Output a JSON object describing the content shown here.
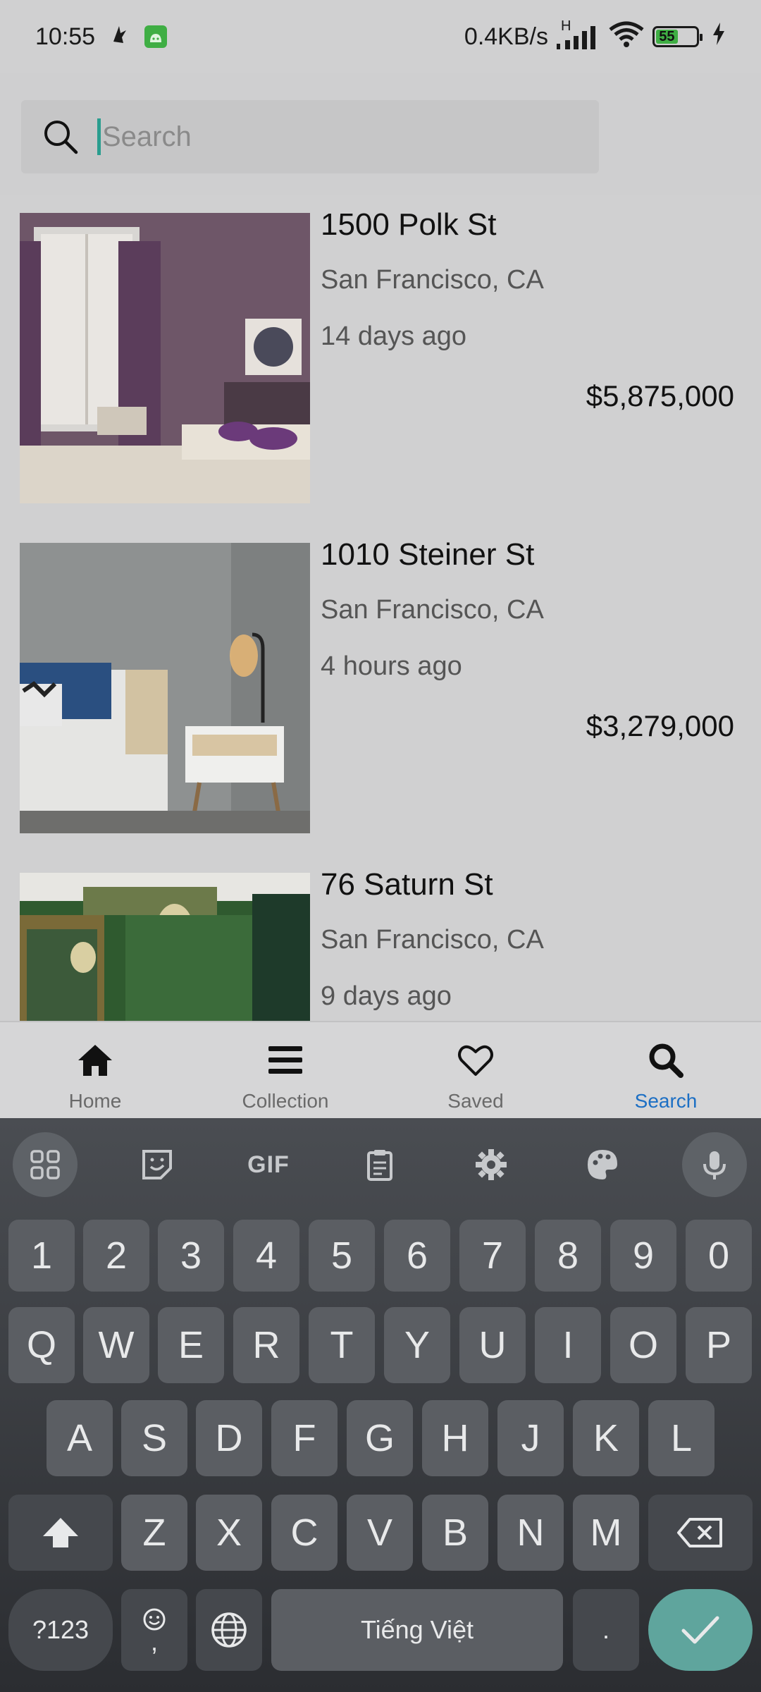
{
  "status_bar": {
    "time": "10:55",
    "network_speed": "0.4KB/s",
    "network_type": "H",
    "battery_level": "55"
  },
  "search": {
    "placeholder": "Search",
    "value": ""
  },
  "listings": [
    {
      "address": "1500 Polk St",
      "city": "San Francisco, CA",
      "posted": "14 days ago",
      "price": "$5,875,000"
    },
    {
      "address": "1010 Steiner St",
      "city": "San Francisco, CA",
      "posted": "4 hours ago",
      "price": "$3,279,000"
    },
    {
      "address": "76 Saturn St",
      "city": "San Francisco, CA",
      "posted": "9 days ago",
      "price": ""
    }
  ],
  "bottom_nav": {
    "items": [
      {
        "label": "Home",
        "icon": "home-icon"
      },
      {
        "label": "Collection",
        "icon": "menu-icon"
      },
      {
        "label": "Saved",
        "icon": "heart-icon"
      },
      {
        "label": "Search",
        "icon": "search-icon",
        "active": true
      }
    ],
    "active_color": "#1c6fc4"
  },
  "keyboard": {
    "tools": [
      "apps-grid-icon",
      "sticker-icon",
      "GIF",
      "clipboard-icon",
      "settings-icon",
      "palette-icon",
      "microphone-icon"
    ],
    "gif_label": "GIF",
    "number_row": [
      "1",
      "2",
      "3",
      "4",
      "5",
      "6",
      "7",
      "8",
      "9",
      "0"
    ],
    "row1": [
      "Q",
      "W",
      "E",
      "R",
      "T",
      "Y",
      "U",
      "I",
      "O",
      "P"
    ],
    "row2": [
      "A",
      "S",
      "D",
      "F",
      "G",
      "H",
      "J",
      "K",
      "L"
    ],
    "row3": [
      "Z",
      "X",
      "C",
      "V",
      "B",
      "N",
      "M"
    ],
    "symbols_label": "?123",
    "comma_label": ",",
    "space_label": "Tiếng Việt",
    "period_label": ".",
    "enter_color": "#5fa59d"
  }
}
